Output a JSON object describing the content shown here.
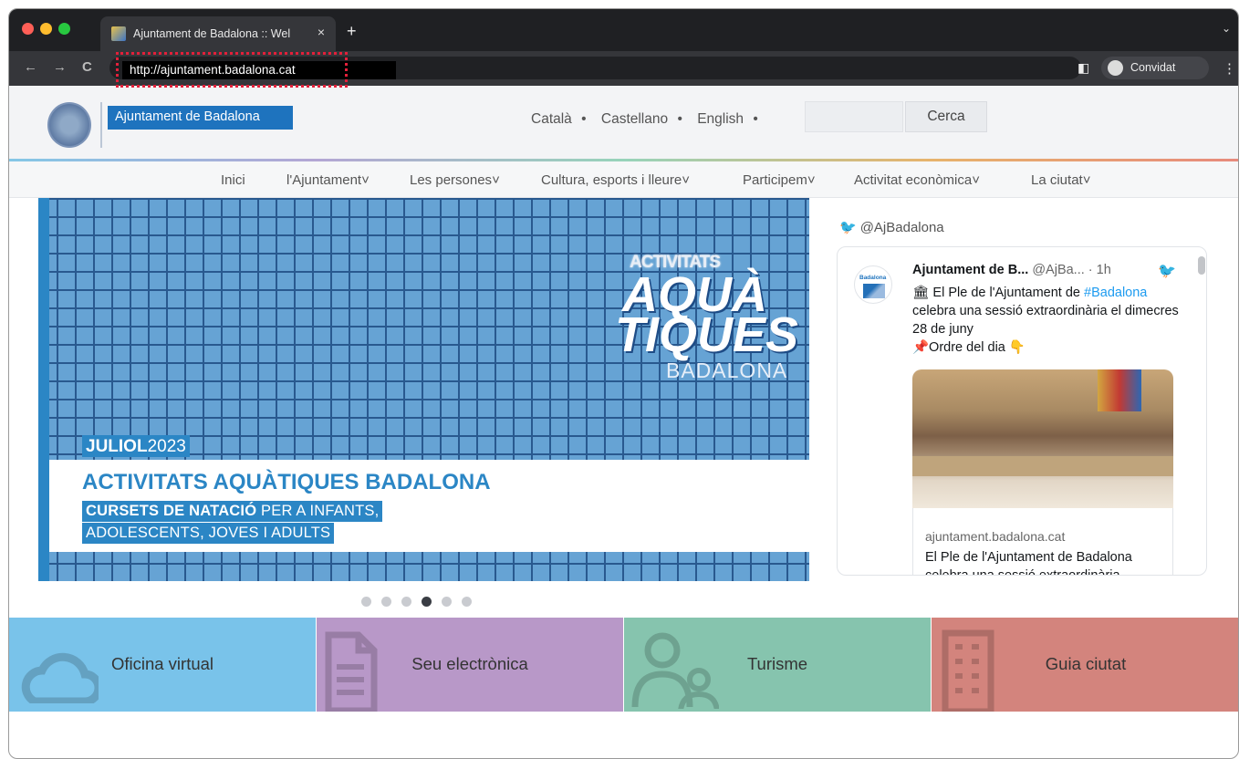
{
  "browser": {
    "tab_title": "Ajuntament de Badalona :: Wel",
    "tab_close": "×",
    "new_tab": "+",
    "tabs_menu": "⌄",
    "back": "←",
    "forward": "→",
    "reload": "C",
    "url": "http://ajuntament.badalona.cat",
    "profile_label": "Convidat",
    "menu": "⋮"
  },
  "header": {
    "brand": "Ajuntament de Badalona",
    "languages": [
      "Català",
      "Castellano",
      "English"
    ],
    "separator": "•",
    "search_button": "Cerca"
  },
  "nav": [
    "Inici",
    "l'Ajuntament",
    "Les persones",
    "Cultura, esports i lleure",
    "Participem",
    "Activitat econòmica",
    "La ciutat"
  ],
  "nav_chevron": "˅",
  "hero": {
    "small": "ACTIVITATS",
    "big1": "AQUÀ",
    "big2": "TIQUES",
    "city": "BADALONA",
    "month_bold": "JULIOL",
    "month_year": "2023",
    "headline": "ACTIVITATS AQUÀTIQUES BADALONA",
    "sub1_bold": "CURSETS DE NATACIÓ",
    "sub1_rest": " PER A INFANTS,",
    "sub2": "ADOLESCENTS, JOVES I ADULTS"
  },
  "carousel": {
    "count": 6,
    "active_index": 3
  },
  "twitter": {
    "handle": "@AjBadalona",
    "avatar_text": "Badalona",
    "author": "Ajuntament de B...",
    "meta": " @AjBa... · 1h",
    "line1_prefix": "🏛 El Ple de l'Ajuntament de ",
    "hashtag": "#Badalona",
    "line2": "celebra una sessió extraordinària el dimecres 28 de juny",
    "line3": "📌Ordre del dia 👇",
    "link_domain": "ajuntament.badalona.cat",
    "link_title": "El Ple de l'Ajuntament de Badalona celebra una sessió extraordinària ..."
  },
  "tiles": [
    {
      "label": "Oficina virtual",
      "color": "#79c3ea"
    },
    {
      "label": "Seu electrònica",
      "color": "#b898c8"
    },
    {
      "label": "Turisme",
      "color": "#86c4ae"
    },
    {
      "label": "Guia ciutat",
      "color": "#d3847d"
    }
  ]
}
